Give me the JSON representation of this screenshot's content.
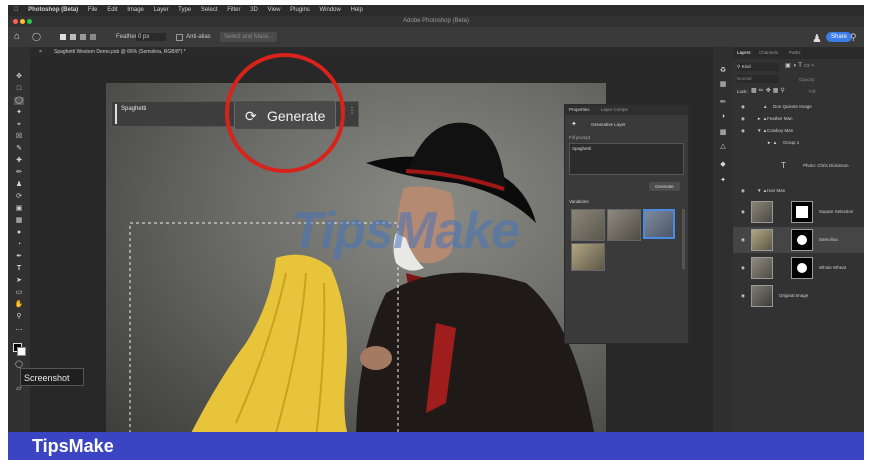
{
  "app": {
    "menubar": [
      "Photoshop (Beta)",
      "File",
      "Edit",
      "Image",
      "Layer",
      "Type",
      "Select",
      "Filter",
      "3D",
      "View",
      "Plugins",
      "Window",
      "Help"
    ],
    "window_title": "Adobe Photoshop (Beta)",
    "share_label": "Share"
  },
  "options": {
    "feather_label": "Feather:",
    "feather_value": "0 px",
    "antialias_label": "Anti-alias",
    "select_mask_label": "Select and Mask..."
  },
  "document": {
    "tab_title": "Spaghetti Western Demo.psb @ 66% (Semolina, RGB/8*) *"
  },
  "generate_bar": {
    "prompt_value": "Spaghetti",
    "generate_label": "Generate"
  },
  "properties": {
    "tabs": [
      "Properties",
      "Layer Comps"
    ],
    "layer_type": "Generative Layer",
    "prompt_label": "Fill prompt",
    "prompt_value": "Spaghetti",
    "generate_button": "Generate",
    "variations_label": "Variations"
  },
  "layers_panel": {
    "tabs": [
      "Layers",
      "Channels",
      "Paths"
    ],
    "kind_label": "Kind",
    "blend_mode": "Normal",
    "opacity_label": "Opacity:",
    "lock_label": "Lock:",
    "fill_label": "Fill:",
    "layers": [
      {
        "name": "Don Quixote Image",
        "type": "group"
      },
      {
        "name": "Feather Man",
        "type": "group"
      },
      {
        "name": "Cowboy Man",
        "type": "group"
      },
      {
        "name": "Group 1",
        "type": "group"
      },
      {
        "name": "Photo: Chris Dickinson",
        "type": "text"
      },
      {
        "name": "Hair Man",
        "type": "group"
      },
      {
        "name": "Square Selection",
        "type": "layer"
      },
      {
        "name": "Semolina",
        "type": "layer"
      },
      {
        "name": "Whole Wheat",
        "type": "layer"
      },
      {
        "name": "Original Image",
        "type": "layer"
      }
    ]
  },
  "tooltip": "Screenshot",
  "watermark": "TipsMake",
  "footer_brand": "TipsMake",
  "colors": {
    "footer_bg": "#3b45c4",
    "highlight_circle": "#d8231b",
    "ui_dark": "#2b2b2b",
    "spaghetti": "#e8c43a"
  }
}
